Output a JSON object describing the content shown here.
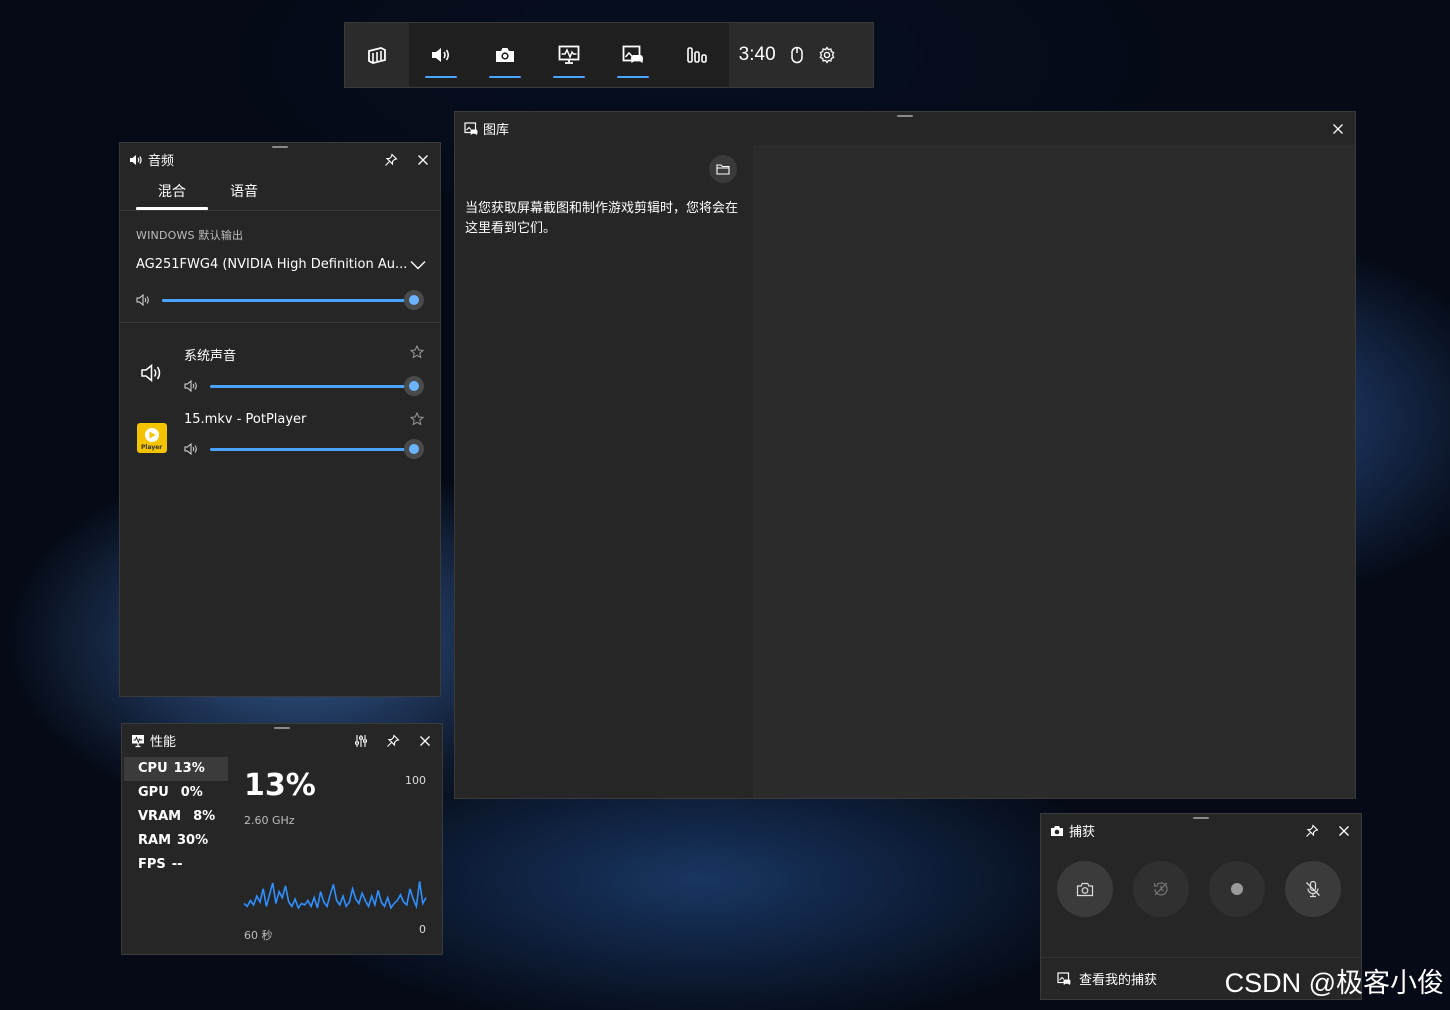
{
  "gamebar": {
    "clock": "3:40",
    "widgets": [
      "audio",
      "capture",
      "performance",
      "xbox-social",
      "resources"
    ]
  },
  "audio": {
    "title": "音频",
    "tabs": [
      "混合",
      "语音"
    ],
    "section_label": "WINDOWS 默认输出",
    "device": "AG251FWG4 (NVIDIA High Definition Au...",
    "master_volume": 100,
    "apps": [
      {
        "name": "系统声音",
        "volume": 100,
        "icon": "speaker-icon"
      },
      {
        "name": "15.mkv - PotPlayer",
        "volume": 100,
        "icon": "potplayer-icon",
        "icon_text": "Player"
      }
    ]
  },
  "gallery": {
    "title": "图库",
    "message": "当您获取屏幕截图和制作游戏剪辑时，您将会在这里看到它们。"
  },
  "performance": {
    "title": "性能",
    "items": [
      {
        "label": "CPU",
        "value": "13%"
      },
      {
        "label": "GPU",
        "value": "0%"
      },
      {
        "label": "VRAM",
        "value": "8%"
      },
      {
        "label": "RAM",
        "value": "30%"
      },
      {
        "label": "FPS",
        "value": "--"
      }
    ],
    "big_value": "13%",
    "frequency": "2.60 GHz",
    "max": "100",
    "min": "0",
    "time_span": "60 秒",
    "history": [
      14,
      12,
      16,
      13,
      19,
      15,
      24,
      12,
      20,
      28,
      14,
      22,
      18,
      26,
      15,
      12,
      17,
      11,
      14,
      13,
      16,
      12,
      18,
      11,
      22,
      15,
      12,
      20,
      27,
      16,
      13,
      19,
      12,
      15,
      24,
      17,
      14,
      21,
      16,
      12,
      19,
      13,
      23,
      15,
      12,
      18,
      11,
      14,
      16,
      20,
      15,
      13,
      24,
      17,
      12,
      29,
      14,
      18
    ]
  },
  "capture": {
    "title": "捕获",
    "view_label": "查看我的捕获"
  },
  "watermark": "CSDN @极客小俊",
  "colors": {
    "accent": "#4aa3ff",
    "panel": "#262626",
    "gamebar": "#1f1f1f"
  }
}
